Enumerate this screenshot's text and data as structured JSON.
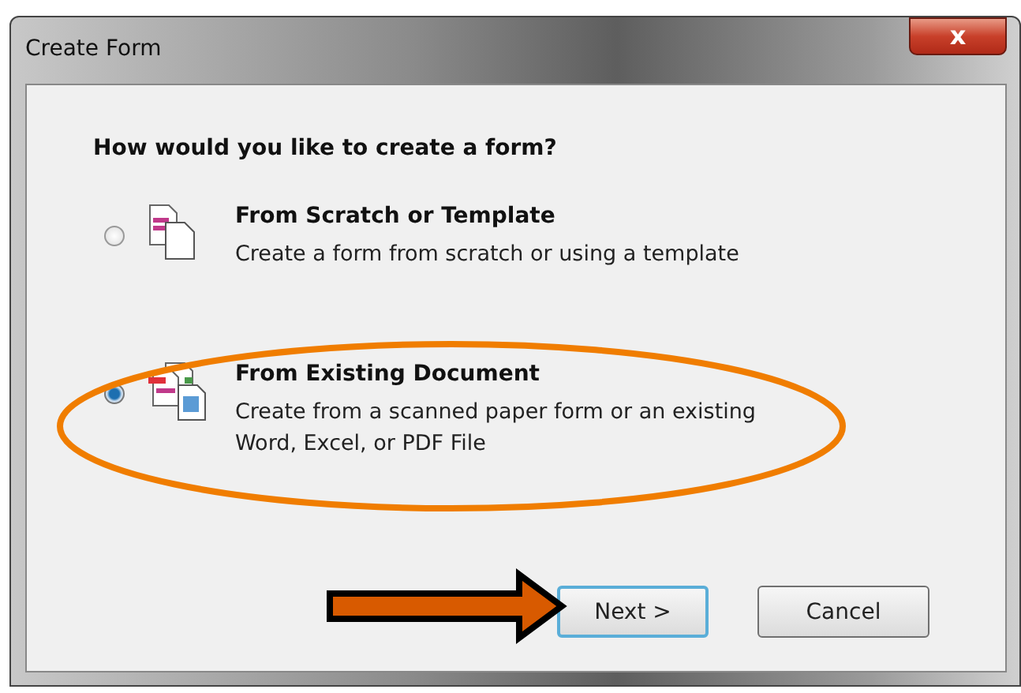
{
  "window": {
    "title": "Create Form",
    "close": "x"
  },
  "heading": "How would you like to create a form?",
  "options": [
    {
      "title": "From Scratch or Template",
      "lines": [
        "Create a form from scratch or using a template"
      ],
      "selected": false,
      "kind": "blank"
    },
    {
      "title": "From Existing Document",
      "lines": [
        "Create from a scanned paper form or an existing",
        "Word, Excel, or PDF File"
      ],
      "selected": true,
      "kind": "existing"
    }
  ],
  "buttons": [
    {
      "label": "Next >",
      "focused": true
    },
    {
      "label": "Cancel",
      "focused": false
    }
  ]
}
